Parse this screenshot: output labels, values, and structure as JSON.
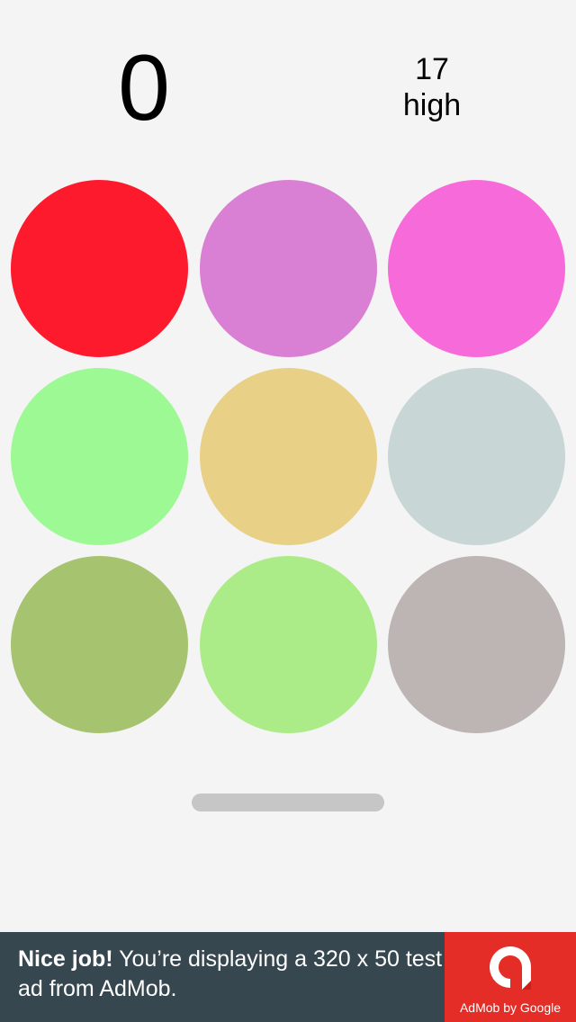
{
  "score": {
    "current": "0",
    "high_value": "17",
    "high_label": "high"
  },
  "grid": {
    "circles": [
      {
        "id": "circle-1",
        "color": "#fc1a2c"
      },
      {
        "id": "circle-2",
        "color": "#da80d4"
      },
      {
        "id": "circle-3",
        "color": "#f66ad9"
      },
      {
        "id": "circle-4",
        "color": "#9cf994"
      },
      {
        "id": "circle-5",
        "color": "#e9d087"
      },
      {
        "id": "circle-6",
        "color": "#c8d6d6"
      },
      {
        "id": "circle-7",
        "color": "#a6c36f"
      },
      {
        "id": "circle-8",
        "color": "#acec88"
      },
      {
        "id": "circle-9",
        "color": "#bdb5b3"
      }
    ]
  },
  "progress": {
    "fraction": 1.0,
    "color": "#c6c6c6"
  },
  "ad": {
    "headline": "Nice job!",
    "body": " You’re displaying a 320 x 50 test ad from AdMob.",
    "logo_caption": "AdMob by Google",
    "logo_icon": "admob-logo-icon",
    "background_color": "#37474f",
    "logo_background_color": "#e52d27"
  }
}
